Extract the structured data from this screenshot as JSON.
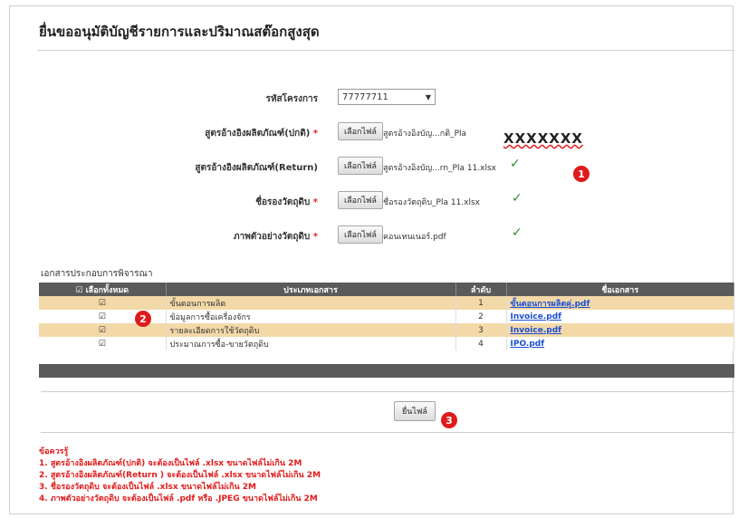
{
  "page_title": "ยื่นขออนุมัติบัญชีรายการและปริมาณสต๊อกสูงสุด",
  "form": {
    "project_code": {
      "label": "รหัสโครงการ",
      "value": "77777711",
      "arrow": "▼"
    },
    "rows": [
      {
        "label": "สูตรอ้างอิงผลิตภัณฑ์(ปกติ)",
        "required": true,
        "button": "เลือกไฟล์",
        "file": "สูตรอ้างอิงบัญ...กติ_Pla",
        "check": ""
      },
      {
        "label": "สูตรอ้างอิงผลิตภัณฑ์(Return)",
        "required": false,
        "button": "เลือกไฟล์",
        "file": "สูตรอ้างอิงบัญ...rn_Pla 11.xlsx",
        "check": "✓"
      },
      {
        "label": "ชื่อรองวัตถุดิบ",
        "required": true,
        "button": "เลือกไฟล์",
        "file": "ชื่อรองวัตถุดิบ_Pla 11.xlsx",
        "check": "✓"
      },
      {
        "label": "ภาพตัวอย่างวัตถุดิบ",
        "required": true,
        "button": "เลือกไฟล์",
        "file": "คอนเทนเนอร์.pdf",
        "check": "✓"
      }
    ],
    "required_mark": "*",
    "annotation_text": "XXXXXXX"
  },
  "markers": {
    "m1": "1",
    "m2": "2",
    "m3": "3"
  },
  "documents": {
    "section_title": "เอกสารประกอบการพิจารณา",
    "headers": {
      "select_all": "☑ เลือกทั้งหมด",
      "type": "ประเภทเอกสาร",
      "order": "ลำดับ",
      "name": "ชื่อเอกสาร"
    },
    "rows": [
      {
        "checked": "☑",
        "type": "ขั้นตอนการผลิต",
        "order": "1",
        "name": "ขั้นตอนการผลิตคู่.pdf"
      },
      {
        "checked": "☑",
        "type": "ข้อมูลการซื้อเครื่องจักร",
        "order": "2",
        "name": "Invoice.pdf"
      },
      {
        "checked": "☑",
        "type": "รายละเอียดการใช้วัตถุดิบ",
        "order": "3",
        "name": "Invoice.pdf"
      },
      {
        "checked": "☑",
        "type": "ประมาณการซื้อ-ขายวัตถุดิบ",
        "order": "4",
        "name": "IPO.pdf"
      }
    ]
  },
  "submit_label": "ยื่นไฟล์",
  "notes": {
    "heading": "ข้อควรรู้",
    "items": [
      "1. สูตรอ้างอิงผลิตภัณฑ์(ปกติ) จะต้องเป็นไฟล์ .xlsx ขนาดไฟล์ไม่เกิน 2M",
      "2. สูตรอ้างอิงผลิตภัณฑ์(Return ) จะต้องเป็นไฟล์ .xlsx ขนาดไฟล์ไม่เกิน 2M",
      "3. ชื่อรองวัตถุดิบ จะต้องเป็นไฟล์ .xlsx ขนาดไฟล์ไม่เกิน 2M",
      "4. ภาพตัวอย่างวัตถุดิบ จะต้องเป็นไฟล์ .pdf หรือ .JPEG ขนาดไฟล์ไม่เกิน 2M"
    ]
  },
  "colors": {
    "marker": "#e01b1b",
    "row_highlight": "#f3d9a8",
    "header": "#5a5a5a",
    "link": "#1a4fd6",
    "check": "#2e8b2e"
  }
}
